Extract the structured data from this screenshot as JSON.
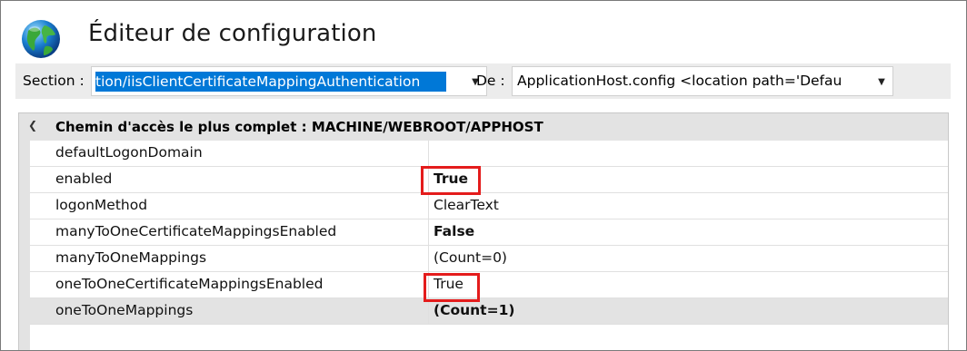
{
  "header": {
    "title": "Éditeur de configuration",
    "icon": "globe-icon"
  },
  "toolbar": {
    "section_label": "Section :",
    "section_value": "tion/iisClientCertificateMappingAuthentication",
    "de_label": "De :",
    "de_value": "ApplicationHost.config <location path='Defau"
  },
  "grid": {
    "category_label": "Chemin d'accès le plus complet : MACHINE/WEBROOT/APPHOST",
    "properties": [
      {
        "name": "defaultLogonDomain",
        "value": "",
        "bold": false,
        "highlighted": false
      },
      {
        "name": "enabled",
        "value": "True",
        "bold": true,
        "highlighted": true
      },
      {
        "name": "logonMethod",
        "value": "ClearText",
        "bold": false,
        "highlighted": false
      },
      {
        "name": "manyToOneCertificateMappingsEnabled",
        "value": "False",
        "bold": true,
        "highlighted": false
      },
      {
        "name": "manyToOneMappings",
        "value": "(Count=0)",
        "bold": false,
        "highlighted": false
      },
      {
        "name": "oneToOneCertificateMappingsEnabled",
        "value": "True",
        "bold": false,
        "highlighted": true
      },
      {
        "name": "oneToOneMappings",
        "value": "(Count=1)",
        "bold": true,
        "highlighted": false,
        "selected": true
      }
    ]
  },
  "colors": {
    "selection": "#0078d7",
    "highlight_box": "#e41c1c",
    "category_bg": "#e3e3e3"
  }
}
